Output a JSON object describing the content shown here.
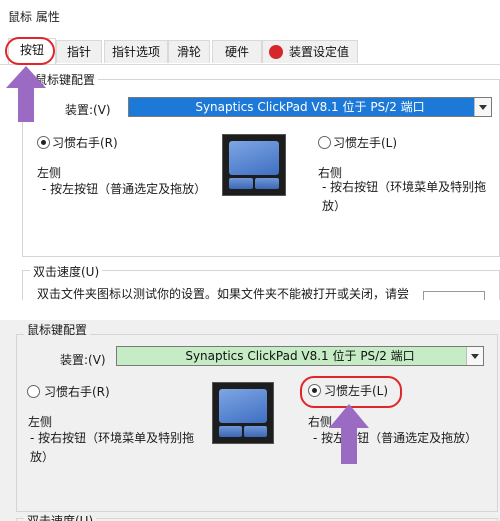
{
  "window": {
    "title": "鼠标 属性"
  },
  "tabs": [
    {
      "label": "按钮",
      "active": true
    },
    {
      "label": "指针"
    },
    {
      "label": "指针选项"
    },
    {
      "label": "滑轮"
    },
    {
      "label": "硬件"
    },
    {
      "label": "装置设定值"
    }
  ],
  "top": {
    "group_label": "鼠标键配置",
    "device_label": "装置:(V)",
    "device_value": "Synaptics ClickPad V8.1 位于 PS/2 端口",
    "right_hand_label": "习惯右手(R)",
    "left_hand_label": "习惯左手(L)",
    "left_side_title": "左侧",
    "left_side_desc": "- 按左按钮（普通选定及拖放）",
    "right_side_title": "右侧",
    "right_side_desc": "- 按右按钮（环境菜单及特别拖放）",
    "speed_label": "双击速度(U)",
    "speed_desc": "双击文件夹图标以测试你的设置。如果文件夹不能被打开或关闭，请尝"
  },
  "bottom": {
    "group_label": "鼠标键配置",
    "device_label": "装置:(V)",
    "device_value": "Synaptics ClickPad V8.1 位于 PS/2 端口",
    "right_hand_label": "习惯右手(R)",
    "left_hand_label": "习惯左手(L)",
    "left_side_title": "左侧",
    "left_side_desc": "- 按右按钮（环境菜单及特别拖放）",
    "right_side_title": "右侧",
    "right_side_desc": "- 按左按钮（普通选定及拖放）",
    "speed_label": "双击速度(U)"
  },
  "colors": {
    "tab_highlight": "#e0262b",
    "arrow": "#9b6bc4",
    "select_top": "#1c79d8",
    "select_bottom": "#c5ecc5"
  }
}
